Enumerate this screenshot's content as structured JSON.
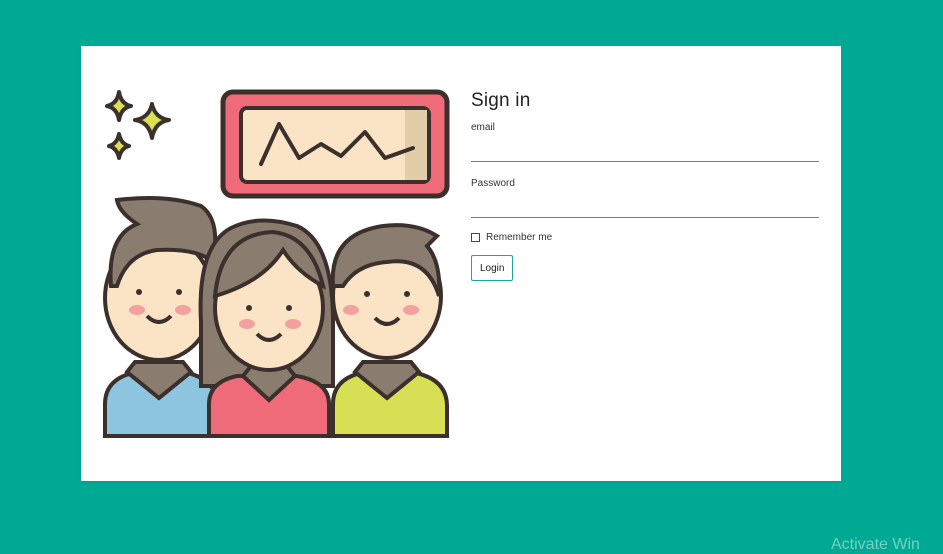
{
  "form": {
    "title": "Sign in",
    "email_label": "email",
    "email_value": "",
    "password_label": "Password",
    "password_value": "",
    "remember_label": "Remember me",
    "remember_checked": false,
    "login_label": "Login"
  },
  "watermark": "Activate Win",
  "colors": {
    "background": "#00a994",
    "accent": "#1aa896",
    "monitor_frame": "#f06b7a",
    "sparkle": "#d9e055"
  },
  "illustration": {
    "icon": "team-people-illustration"
  }
}
